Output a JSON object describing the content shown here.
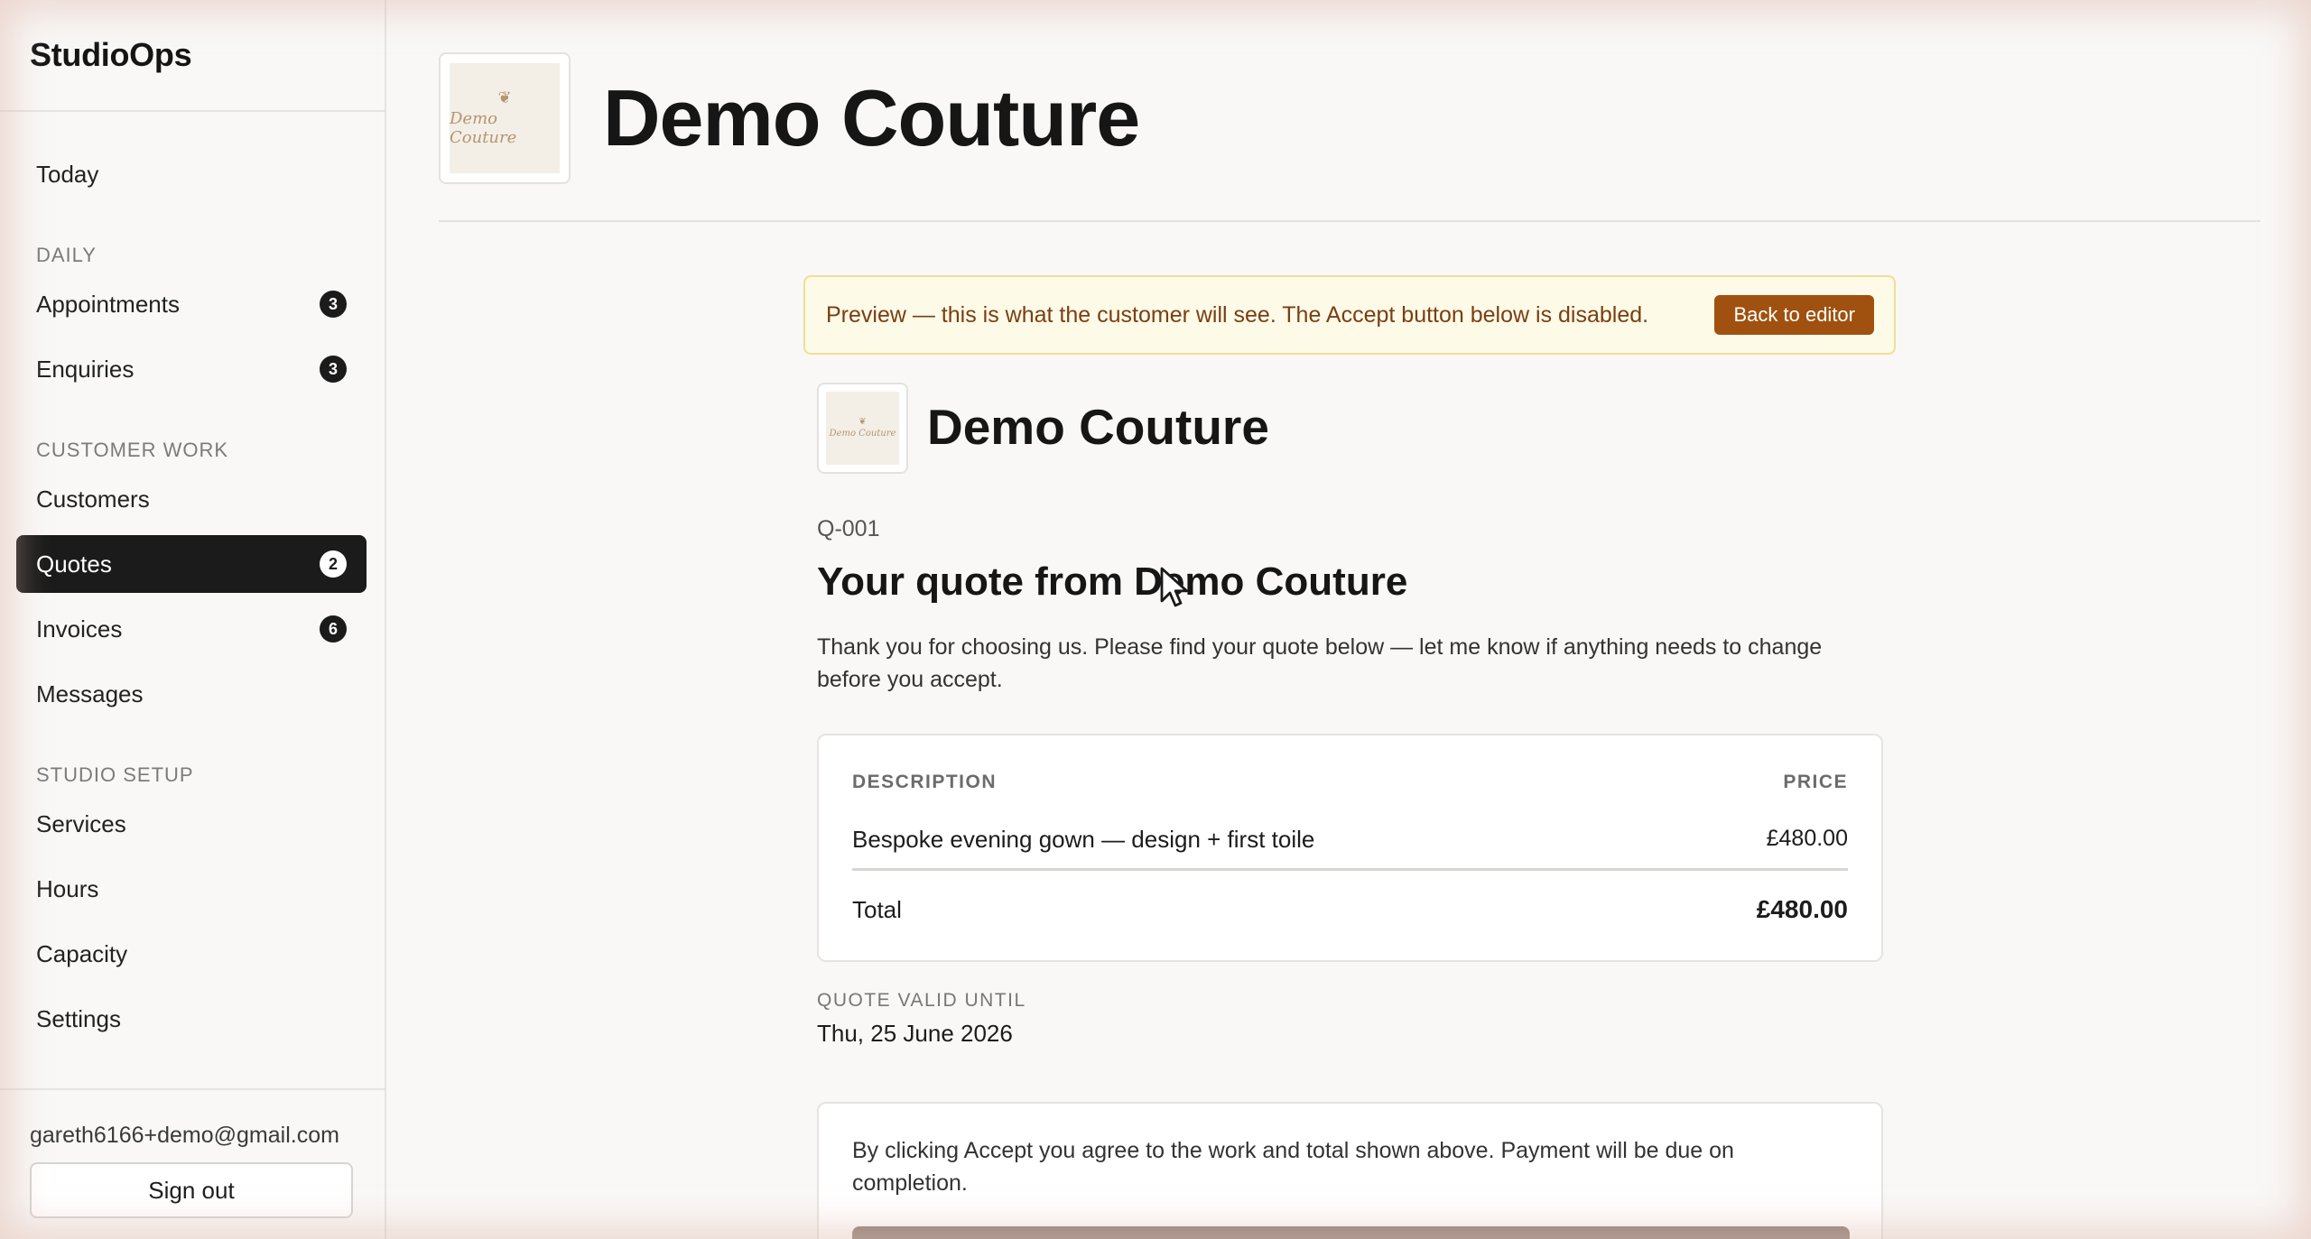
{
  "app": {
    "name": "StudioOps"
  },
  "sidebar": {
    "today": "Today",
    "sections": {
      "daily": "DAILY",
      "customer_work": "CUSTOMER WORK",
      "studio_setup": "STUDIO SETUP"
    },
    "items": [
      {
        "label": "Appointments",
        "badge": "3"
      },
      {
        "label": "Enquiries",
        "badge": "3"
      },
      {
        "label": "Customers"
      },
      {
        "label": "Quotes",
        "badge": "2",
        "active": true
      },
      {
        "label": "Invoices",
        "badge": "6"
      },
      {
        "label": "Messages"
      },
      {
        "label": "Services"
      },
      {
        "label": "Hours"
      },
      {
        "label": "Capacity"
      },
      {
        "label": "Settings"
      }
    ],
    "user_email": "gareth6166+demo@gmail.com",
    "sign_out": "Sign out"
  },
  "header": {
    "logo_text": "Demo Couture",
    "title": "Demo Couture"
  },
  "preview": {
    "message": "Preview — this is what the customer will see. The Accept button below is disabled.",
    "back_button": "Back to editor"
  },
  "quote": {
    "logo_text": "Demo Couture",
    "business_name": "Demo Couture",
    "number": "Q-001",
    "heading": "Your quote from Demo Couture",
    "intro": "Thank you for choosing us. Please find your quote below — let me know if anything needs to change before you accept.",
    "table": {
      "columns": [
        "DESCRIPTION",
        "PRICE"
      ],
      "rows": [
        {
          "description": "Bespoke evening gown — design + first toile",
          "price": "£480.00"
        }
      ],
      "total_label": "Total",
      "total_value": "£480.00"
    },
    "valid_until_label": "QUOTE VALID UNTIL",
    "valid_until": "Thu, 25 June 2026",
    "accept_terms": "By clicking Accept you agree to the work and total shown above. Payment will be due on completion."
  },
  "colors": {
    "accent": "#a0510f",
    "banner_bg": "#fefae8",
    "banner_border": "#f1dd96",
    "active_nav": "#1b1b1b",
    "accept_disabled": "#8d8078"
  }
}
